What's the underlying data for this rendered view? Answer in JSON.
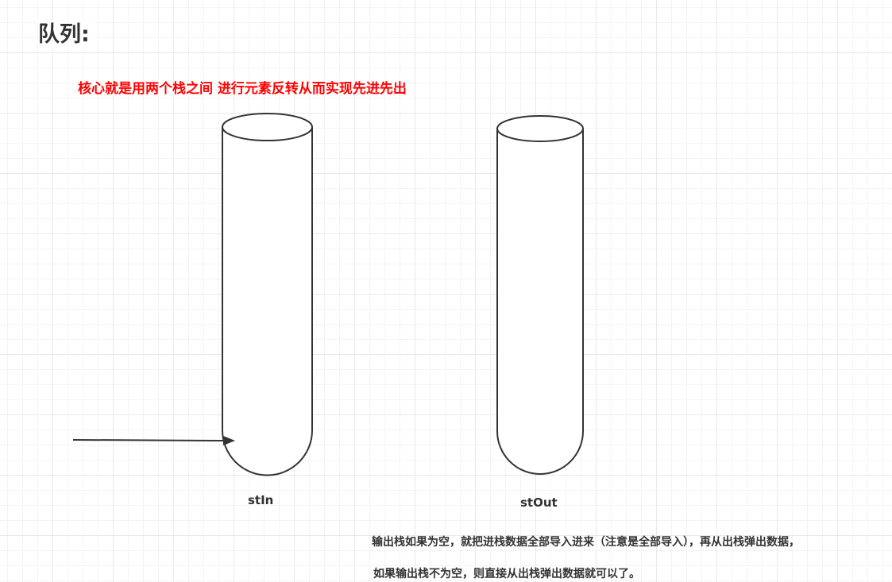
{
  "page": {
    "title": "队列:",
    "core_text": "核心就是用两个栈之间 进行元素反转从而实现先进先出",
    "core_text_color": "#ff0000"
  },
  "diagram": {
    "stack_in_label": "stIn",
    "stack_out_label": "stOut",
    "note_line_1": "输出栈如果为空，就把进栈数据全部导入进来（注意是全部导入），再从出栈弹出数据，",
    "note_line_2": "如果输出栈不为空，则直接从出栈弹出数据就可以了。"
  }
}
